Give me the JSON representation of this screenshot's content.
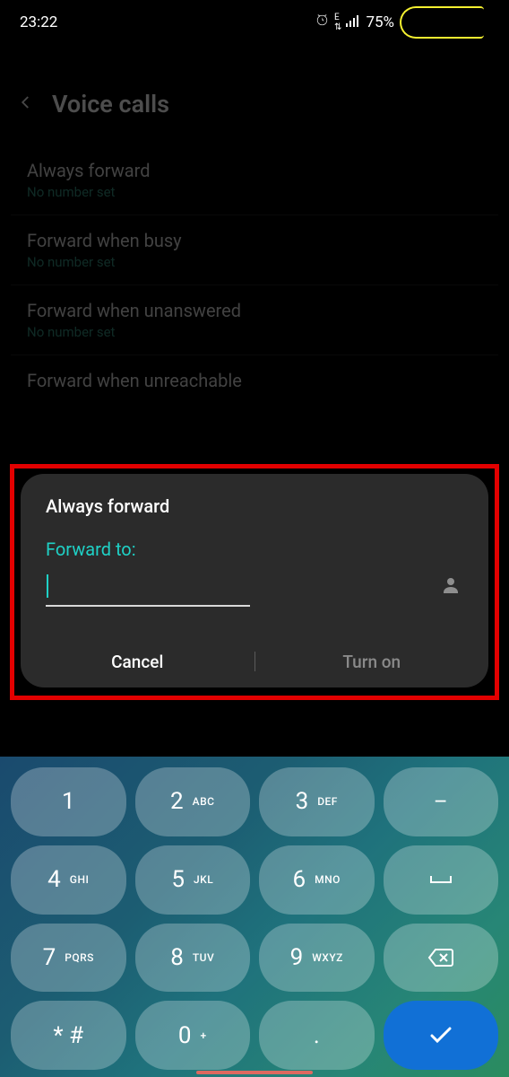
{
  "statusbar": {
    "time": "23:22",
    "battery": "75%"
  },
  "header": {
    "title": "Voice calls"
  },
  "settings": [
    {
      "title": "Always forward",
      "sub": "No number set"
    },
    {
      "title": "Forward when busy",
      "sub": "No number set"
    },
    {
      "title": "Forward when unanswered",
      "sub": "No number set"
    },
    {
      "title": "Forward when unreachable",
      "sub": ""
    }
  ],
  "dialog": {
    "title": "Always forward",
    "label": "Forward to:",
    "input": "",
    "cancel": "Cancel",
    "confirm": "Turn on"
  },
  "keypad": {
    "rows": [
      [
        {
          "n": "1",
          "l": ""
        },
        {
          "n": "2",
          "l": "ABC"
        },
        {
          "n": "3",
          "l": "DEF"
        },
        {
          "n": "–",
          "l": "",
          "sym": true
        }
      ],
      [
        {
          "n": "4",
          "l": "GHI"
        },
        {
          "n": "5",
          "l": "JKL"
        },
        {
          "n": "6",
          "l": "MNO"
        },
        {
          "n": "␣",
          "l": "",
          "sym": true,
          "space": true
        }
      ],
      [
        {
          "n": "7",
          "l": "PQRS"
        },
        {
          "n": "8",
          "l": "TUV"
        },
        {
          "n": "9",
          "l": "WXYZ"
        },
        {
          "n": "⌫",
          "l": "",
          "sym": true,
          "backspace": true
        }
      ],
      [
        {
          "n": "* #",
          "l": ""
        },
        {
          "n": "0",
          "l": "+"
        },
        {
          "n": ".",
          "l": ""
        },
        {
          "n": "✓",
          "l": "",
          "sym": true,
          "done": true
        }
      ]
    ]
  }
}
